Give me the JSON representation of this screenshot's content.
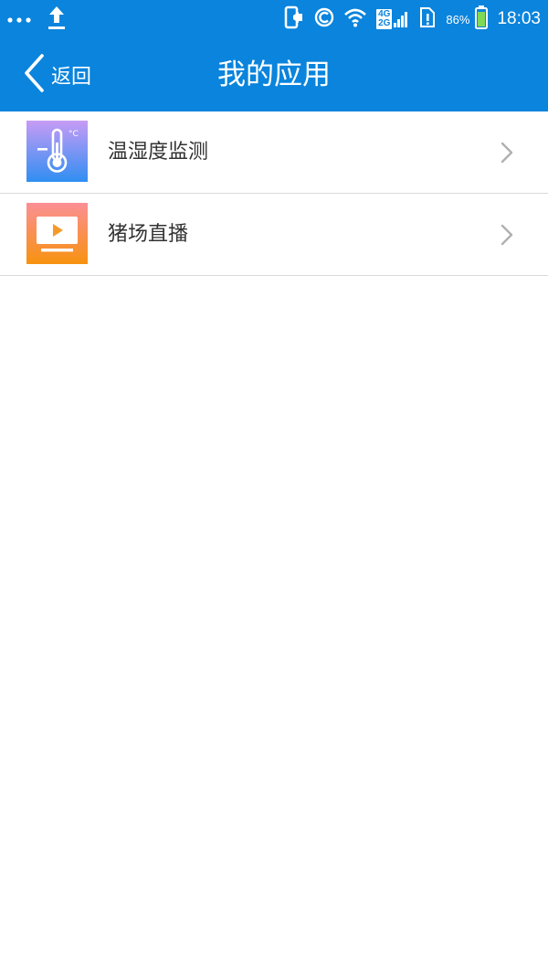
{
  "status_bar": {
    "network_types": [
      "4G",
      "2G"
    ],
    "battery_percent": "86%",
    "time": "18:03"
  },
  "nav": {
    "back_label": "返回",
    "title": "我的应用"
  },
  "apps": [
    {
      "label": "温湿度监测",
      "icon": "thermometer-icon",
      "icon_text": "°C"
    },
    {
      "label": "猪场直播",
      "icon": "tv-play-icon"
    }
  ],
  "colors": {
    "header_bg": "#0a84dc",
    "divider": "#d9d9d9",
    "text": "#333333",
    "chevron": "#b0b0b0"
  }
}
